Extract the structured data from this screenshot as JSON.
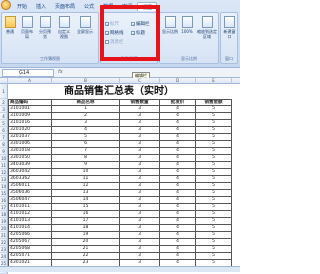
{
  "ribbon": {
    "tabs": [
      "开始",
      "插入",
      "页面布局",
      "公式",
      "数据",
      "审阅",
      "视图"
    ],
    "active_tab": 6,
    "groups": {
      "workbook_views": {
        "label": "工作簿视图",
        "buttons": [
          "普通",
          "页面布局",
          "分页预览",
          "自定义视图",
          "全屏显示"
        ]
      },
      "show_hide": {
        "label": "显示/隐藏",
        "items": [
          {
            "label": "标尺",
            "checked": true,
            "enabled": false
          },
          {
            "label": "编辑栏",
            "checked": true,
            "enabled": true
          },
          {
            "label": "网格线",
            "checked": true,
            "enabled": true
          },
          {
            "label": "标题",
            "checked": true,
            "enabled": true
          },
          {
            "label": "消息栏",
            "checked": false,
            "enabled": false
          }
        ]
      },
      "zoom": {
        "label": "显示比例",
        "buttons": [
          "显示比例",
          "100%",
          "缩放到选定区域"
        ]
      },
      "window": {
        "label": "窗口",
        "buttons": [
          "新建窗口"
        ]
      }
    }
  },
  "formula_bar": {
    "name_box": "G14",
    "fx": "fx",
    "tooltip": "编辑栏"
  },
  "columns": [
    "A",
    "B",
    "C",
    "D",
    "E"
  ],
  "sheet": {
    "title": "商品销售汇总表（实时）",
    "headers": [
      "商品编码",
      "商品名称",
      "销售数量",
      "批发价",
      "销售金额"
    ],
    "rows": [
      [
        "3101001",
        "1",
        "3",
        "4",
        "5"
      ],
      [
        "3101009",
        "2",
        "3",
        "4",
        "5"
      ],
      [
        "3101016",
        "3",
        "3",
        "4",
        "5"
      ],
      [
        "3201020",
        "4",
        "3",
        "4",
        "5"
      ],
      [
        "3201037",
        "5",
        "3",
        "4",
        "5"
      ],
      [
        "3301006",
        "6",
        "3",
        "4",
        "5"
      ],
      [
        "3301018",
        "7",
        "3",
        "4",
        "5"
      ],
      [
        "3301050",
        "8",
        "3",
        "4",
        "5"
      ],
      [
        "3403039",
        "9",
        "3",
        "4",
        "5"
      ],
      [
        "3603042",
        "10",
        "3",
        "4",
        "5"
      ],
      [
        "3603362",
        "11",
        "3",
        "4",
        "5"
      ],
      [
        "3506011",
        "12",
        "3",
        "4",
        "5"
      ],
      [
        "3506036",
        "13",
        "3",
        "4",
        "5"
      ],
      [
        "3506047",
        "14",
        "3",
        "4",
        "5"
      ],
      [
        "4101011",
        "15",
        "3",
        "4",
        "5"
      ],
      [
        "4101012",
        "16",
        "3",
        "4",
        "5"
      ],
      [
        "4101013",
        "17",
        "3",
        "4",
        "5"
      ],
      [
        "4101014",
        "18",
        "3",
        "4",
        "5"
      ],
      [
        "4205066",
        "19",
        "3",
        "4",
        "5"
      ],
      [
        "4205067",
        "20",
        "3",
        "4",
        "5"
      ],
      [
        "4205068",
        "21",
        "3",
        "4",
        "5"
      ],
      [
        "4205071",
        "22",
        "3",
        "4",
        "5"
      ],
      [
        "4301021",
        "23",
        "3",
        "4",
        "5"
      ]
    ]
  },
  "row_numbers": [
    "1",
    "2",
    "3",
    "4",
    "5",
    "6",
    "7",
    "8",
    "9",
    "10",
    "11",
    "12",
    "13",
    "14",
    "15",
    "16",
    "17",
    "18",
    "19",
    "20",
    "21",
    "22",
    "23",
    "24",
    "25",
    "26"
  ],
  "highlight": {
    "color": "#e8131a"
  }
}
